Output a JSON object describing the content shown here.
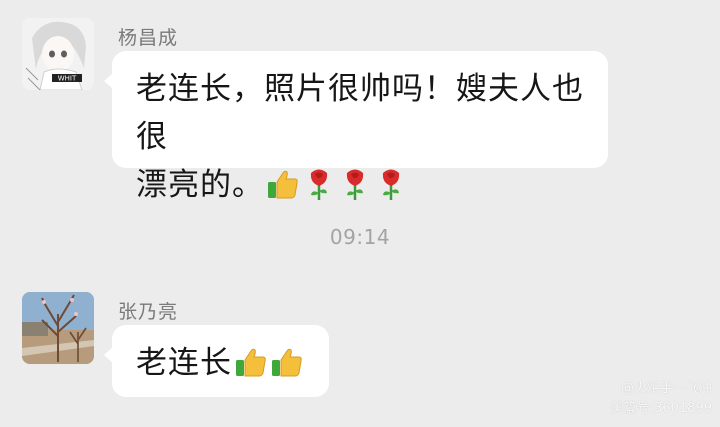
{
  "messages": [
    {
      "sender": "杨昌成",
      "text": "老连长，照片很帅吗！嫂夫人也很漂亮的。",
      "text_line1": "老连长，照片很帅吗！嫂夫人也很",
      "text_line2": "漂亮的。",
      "emojis": [
        "thumbs-up",
        "rose",
        "rose",
        "rose"
      ],
      "avatar_icon": "anime-girl-avatar"
    },
    {
      "sender": "张乃亮",
      "text": "老连长",
      "emojis": [
        "thumbs-up",
        "thumbs-up"
      ],
      "avatar_icon": "landscape-avatar"
    }
  ],
  "timestamp": "09:14",
  "watermark": {
    "line1": "@火炬手一飞冲",
    "line2": "美篇号:3601899"
  },
  "colors": {
    "background": "#ececec",
    "bubble": "#ffffff",
    "sender_name": "#7a7a7a",
    "timestamp": "#a3a3a3"
  }
}
